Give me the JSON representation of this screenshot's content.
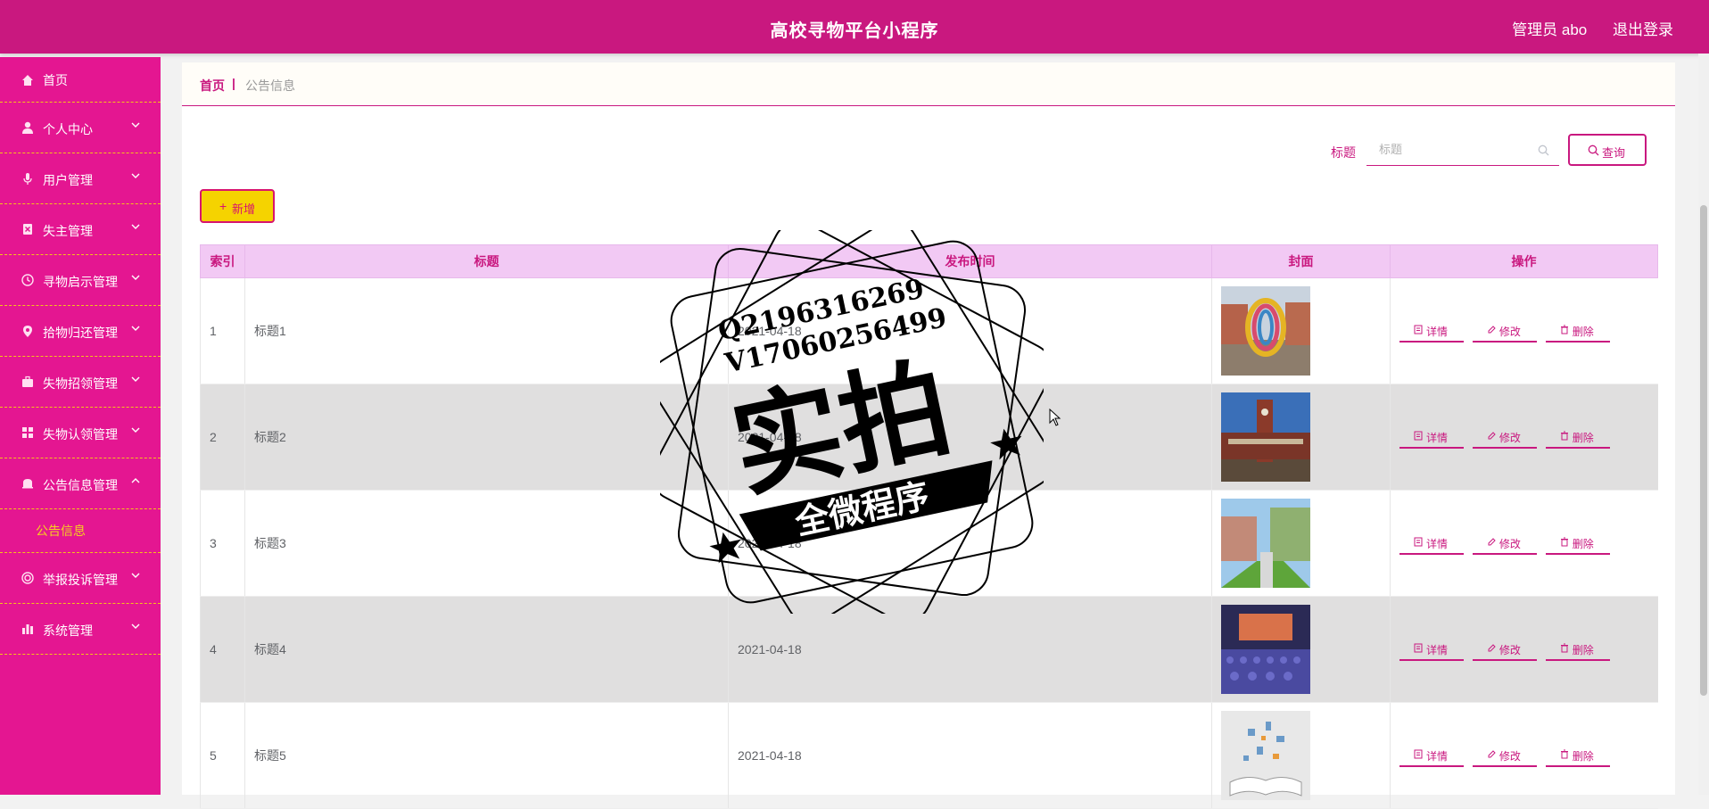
{
  "header": {
    "title": "高校寻物平台小程序",
    "user": "管理员 abo",
    "logout": "退出登录",
    "bg_color": "#c9187f"
  },
  "sidebar": {
    "bg_color": "#e41691",
    "items": [
      {
        "label": "首页",
        "icon": "home-icon"
      },
      {
        "label": "个人中心",
        "icon": "user-icon"
      },
      {
        "label": "用户管理",
        "icon": "microphone-icon"
      },
      {
        "label": "失主管理",
        "icon": "delete-icon"
      },
      {
        "label": "寻物启示管理",
        "icon": "clock-icon"
      },
      {
        "label": "拾物归还管理",
        "icon": "location-icon"
      },
      {
        "label": "失物招领管理",
        "icon": "briefcase-icon"
      },
      {
        "label": "失物认领管理",
        "icon": "grid-icon"
      },
      {
        "label": "公告信息管理",
        "icon": "bell-icon",
        "expanded": true
      },
      {
        "label": "举报投诉管理",
        "icon": "circle-icon"
      },
      {
        "label": "系统管理",
        "icon": "chart-icon"
      }
    ],
    "sub_items": [
      {
        "label": "公告信息",
        "active": true
      }
    ]
  },
  "breadcrumb": {
    "home": "首页",
    "separator": "|",
    "current": "公告信息"
  },
  "search": {
    "label": "标题",
    "placeholder": "标题",
    "button": "查询"
  },
  "toolbar": {
    "add_label": "新增",
    "add_symbol": "+"
  },
  "table": {
    "columns": [
      "索引",
      "标题",
      "发布时间",
      "封面",
      "操作"
    ],
    "rows": [
      {
        "index": "1",
        "title": "标题1",
        "date": "2021-04-18",
        "cover": "colorful-ring-sculpture"
      },
      {
        "index": "2",
        "title": "标题2",
        "date": "2021-04-18",
        "cover": "campus-clock-tower"
      },
      {
        "index": "3",
        "title": "标题3",
        "date": "2021-04-18",
        "cover": "campus-courtyard"
      },
      {
        "index": "4",
        "title": "标题4",
        "date": "2021-04-18",
        "cover": "lecture-hall"
      },
      {
        "index": "5",
        "title": "标题5",
        "date": "2021-04-18",
        "cover": "open-book"
      }
    ],
    "actions": [
      "详情",
      "修改",
      "删除"
    ],
    "header_bg": "#f2c9f4",
    "stripe_bg": "#e0dfdf"
  },
  "watermark": {
    "line1": "Q2196316269",
    "line2": "V17060256499",
    "big": "实拍",
    "ribbon": "全微程序"
  }
}
